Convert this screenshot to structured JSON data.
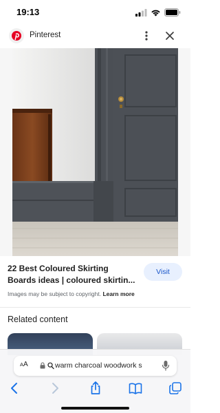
{
  "status_bar": {
    "time": "19:13"
  },
  "header": {
    "site_name": "Pinterest"
  },
  "image": {
    "description_icon": "google-lens-icon"
  },
  "result": {
    "title_line1": "22 Best Coloured Skirting",
    "title_line2": "Boards ideas | coloured skirtin...",
    "visit_label": "Visit",
    "copyright_text": "Images may be subject to copyright.",
    "learn_more": "Learn more"
  },
  "related": {
    "heading": "Related content"
  },
  "safari": {
    "text_size_small": "A",
    "text_size_large": "A",
    "url": "warm charcoal woodwork s"
  },
  "colors": {
    "visit_bg": "#e8f0fe",
    "visit_text": "#1a56c9",
    "pinterest_red": "#e60023",
    "accent_blue": "#1a73e8"
  },
  "icons": [
    "pinterest-logo",
    "more-vert-icon",
    "close-icon",
    "google-lens-icon",
    "lock-icon",
    "search-icon",
    "microphone-icon",
    "back-icon",
    "forward-icon",
    "share-icon",
    "bookmarks-icon",
    "tabs-icon"
  ]
}
